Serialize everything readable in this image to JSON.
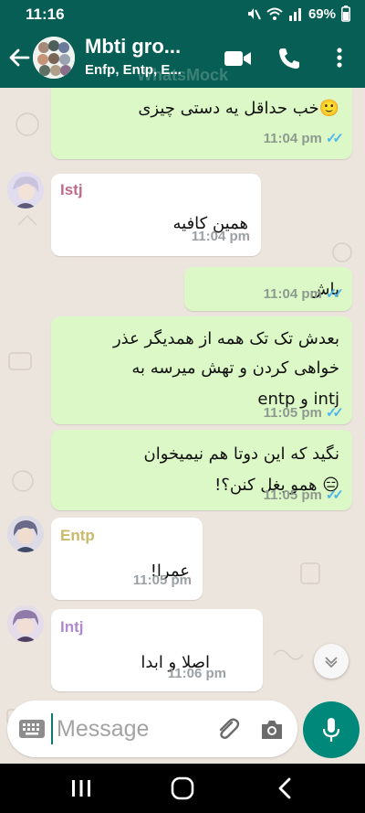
{
  "status_bar": {
    "time": "11:16",
    "battery": "69%"
  },
  "header": {
    "title": "Mbti gro...",
    "subtitle": "Enfp, Entp, E...",
    "watermark": "WhatsMock"
  },
  "messages": [
    {
      "type": "out",
      "text": "🙂خب حداقل یه دستی چیزی",
      "time": "11:04 pm"
    },
    {
      "type": "in",
      "sender": "Istj",
      "text": "همین کافیه",
      "time": "11:04 pm"
    },
    {
      "type": "out",
      "text": "باش",
      "time": "11:04 pm"
    },
    {
      "type": "out",
      "lines": [
        "بعدش تک تک همه از همدیگر عذر",
        "خواهی کردن و تهش میرسه به",
        "intj و entp"
      ],
      "time": "11:05 pm"
    },
    {
      "type": "out",
      "lines": [
        "نگید که این دوتا هم نیمیخوان",
        "😑 همو بغل کنن؟!"
      ],
      "time": "11:05 pm"
    },
    {
      "type": "in",
      "sender": "Entp",
      "text": "عمرا!",
      "time": "11:05 pm"
    },
    {
      "type": "in",
      "sender": "Intj",
      "text": "اصلا و ابدا",
      "time": "11:06 pm"
    }
  ],
  "composer": {
    "placeholder": "Message"
  },
  "colors": {
    "header": "#075e54",
    "outgoing_bubble": "#dcf8c6",
    "incoming_bubble": "#ffffff",
    "chat_background": "#ece5dd",
    "sender_istj": "#c06a8a",
    "sender_entp": "#c9b96a",
    "sender_intj": "#b08acc",
    "read_ticks": "#4fb6ec",
    "mic_button": "#00897b"
  },
  "icons": {
    "back": "back-arrow-icon",
    "video": "video-call-icon",
    "call": "phone-icon",
    "menu": "more-vert-icon",
    "keyboard": "keyboard-icon",
    "attach": "paperclip-icon",
    "camera": "camera-icon",
    "mic": "mic-icon",
    "scroll": "chevron-down-icon"
  }
}
